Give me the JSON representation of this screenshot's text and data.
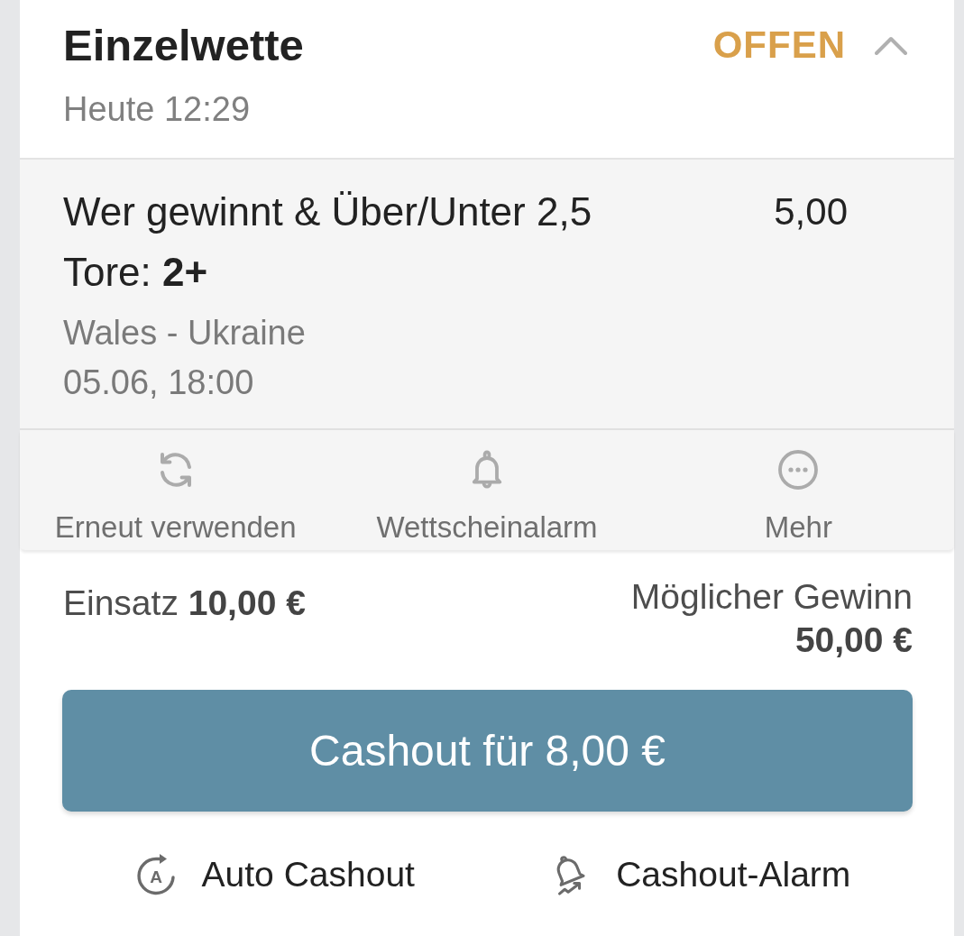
{
  "bet": {
    "title": "Einzelwette",
    "status": "OFFEN",
    "expanded": true,
    "placed": "Heute 12:29"
  },
  "selection": {
    "market": "Wer gewinnt & Über/Unter 2,5 Tore: **2+**",
    "odds": "5,00",
    "event": "Wales - Ukraine",
    "kickoff": "05.06, 18:00"
  },
  "actions": [
    {
      "kind": "reuse",
      "label": "Erneut verwenden"
    },
    {
      "kind": "alert",
      "label": "Wettscheinalarm"
    },
    {
      "kind": "more",
      "label": "Mehr"
    }
  ],
  "stake": {
    "text": "Einsatz **10,00 €**"
  },
  "potential_win": {
    "label": "Möglicher Gewinn",
    "amount": "50,00 €"
  },
  "cashout_button": {
    "label": "Cashout für 8,00 €"
  },
  "footer_links": [
    {
      "kind": "auto",
      "label": "Auto Cashout",
      "icon_letter": "A"
    },
    {
      "kind": "alarm",
      "label": "Cashout-Alarm"
    }
  ]
}
